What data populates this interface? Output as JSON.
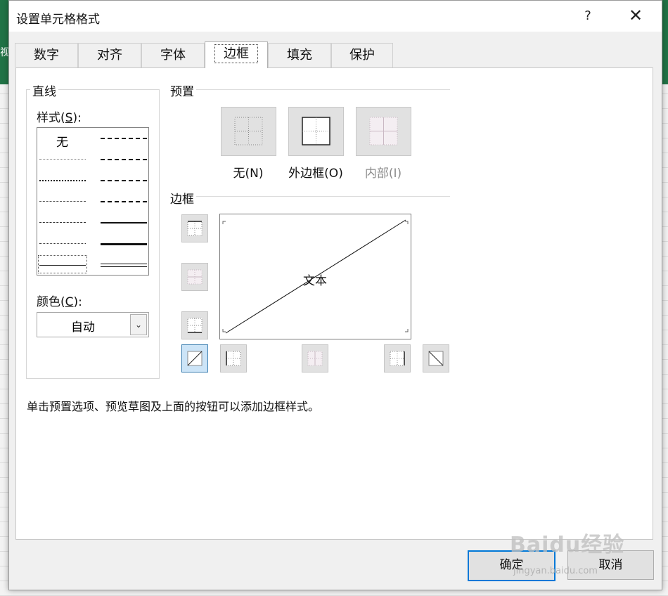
{
  "background": {
    "edge_text": "视",
    "accent": "#217346"
  },
  "dialog": {
    "title": "设置单元格格式",
    "help": "?",
    "close": "✕"
  },
  "tabs": [
    {
      "label": "数字"
    },
    {
      "label": "对齐"
    },
    {
      "label": "字体"
    },
    {
      "label": "边框",
      "active": true
    },
    {
      "label": "填充"
    },
    {
      "label": "保护"
    }
  ],
  "line": {
    "group_label": "直线",
    "style_label": "样式",
    "style_key": "S",
    "style_none": "无",
    "color_label": "颜色",
    "color_key": "C",
    "color_value": "自动"
  },
  "presets": {
    "label": "预置",
    "items": [
      {
        "text": "无",
        "key": "N",
        "icon": "preset-none-icon"
      },
      {
        "text": "外边框",
        "key": "O",
        "icon": "preset-outline-icon"
      },
      {
        "text": "内部",
        "key": "I",
        "icon": "preset-inside-icon",
        "disabled": true
      }
    ]
  },
  "border": {
    "label": "边框",
    "preview_text": "文本"
  },
  "hint": "单击预置选项、预览草图及上面的按钮可以添加边框样式。",
  "buttons": {
    "ok": "确定",
    "cancel": "取消"
  },
  "watermark": {
    "main": "Baidu经验",
    "sub": "jingyan.baidu.com"
  },
  "colors": {
    "selected_button": "#cce4f7",
    "default_button_border": "#0078d7"
  }
}
